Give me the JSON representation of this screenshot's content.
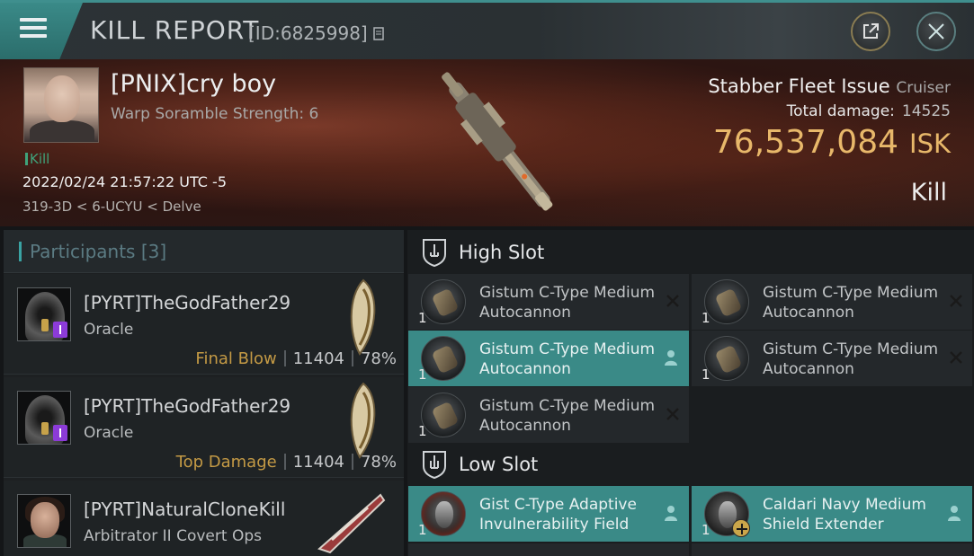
{
  "window": {
    "title": "KILL REPORT",
    "report_id": "[ID:6825998]"
  },
  "victim": {
    "name": "[PNIX]cry boy",
    "subtitle": "Warp Soramble Strength: 6",
    "kill_label": "Kill",
    "datetime": "2022/02/24 21:57:22 UTC -5",
    "location": "319-3D < 6-UCYU < Delve"
  },
  "ship": {
    "name": "Stabber Fleet Issue",
    "class": "Cruiser",
    "total_damage_label": "Total damage:",
    "total_damage": "14525",
    "isk_value": "76,537,084",
    "isk_unit": "ISK",
    "result": "Kill"
  },
  "participants": {
    "header": "Participants [3]",
    "rows": [
      {
        "name": "[PYRT]TheGodFather29",
        "ship": "Oracle",
        "tag": "Final Blow",
        "damage": "11404",
        "percent": "78%"
      },
      {
        "name": "[PYRT]TheGodFather29",
        "ship": "Oracle",
        "tag": "Top Damage",
        "damage": "11404",
        "percent": "78%"
      },
      {
        "name": "[PYRT]NaturalCloneKill",
        "ship": "Arbitrator II Covert Ops"
      }
    ]
  },
  "fitting": {
    "high_slot_label": "High Slot",
    "low_slot_label": "Low Slot",
    "high_modules": [
      {
        "qty": "1",
        "name": "Gistum C-Type Medium Autocannon",
        "status": "destroyed"
      },
      {
        "qty": "1",
        "name": "Gistum C-Type Medium Autocannon",
        "status": "destroyed"
      },
      {
        "qty": "1",
        "name": "Gistum C-Type Medium Autocannon",
        "status": "dropped"
      },
      {
        "qty": "1",
        "name": "Gistum C-Type Medium Autocannon",
        "status": "destroyed"
      },
      {
        "qty": "1",
        "name": "Gistum C-Type Medium Autocannon",
        "status": "destroyed"
      }
    ],
    "low_modules": [
      {
        "qty": "1",
        "name": "Gist C-Type Adaptive Invulnerability Field",
        "status": "dropped"
      },
      {
        "qty": "1",
        "name": "Caldari Navy Medium Shield Extender",
        "status": "dropped"
      }
    ]
  },
  "colors": {
    "accent_teal": "#3a8a87",
    "isk_gold": "#e8b86a",
    "final_blow_gold": "#c49a45",
    "kill_green": "#3fa27a"
  }
}
